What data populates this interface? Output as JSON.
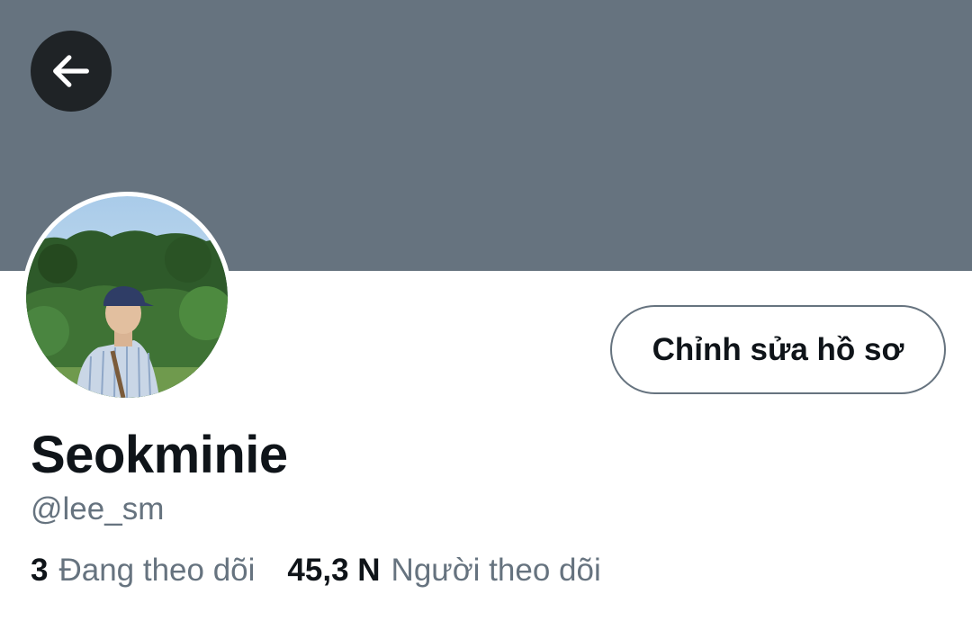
{
  "header": {
    "back_icon": "arrow-left-icon",
    "banner_color": "#66737f"
  },
  "profile": {
    "display_name": "Seokminie",
    "handle": "@lee_sm",
    "edit_button_label": "Chỉnh sửa hồ sơ"
  },
  "stats": {
    "following": {
      "count": "3",
      "label": "Đang theo dõi"
    },
    "followers": {
      "count": "45,3 N",
      "label": "Người theo dõi"
    }
  },
  "colors": {
    "text_primary": "#0f1419",
    "text_secondary": "#66737f",
    "back_button_bg": "#1f2326"
  }
}
